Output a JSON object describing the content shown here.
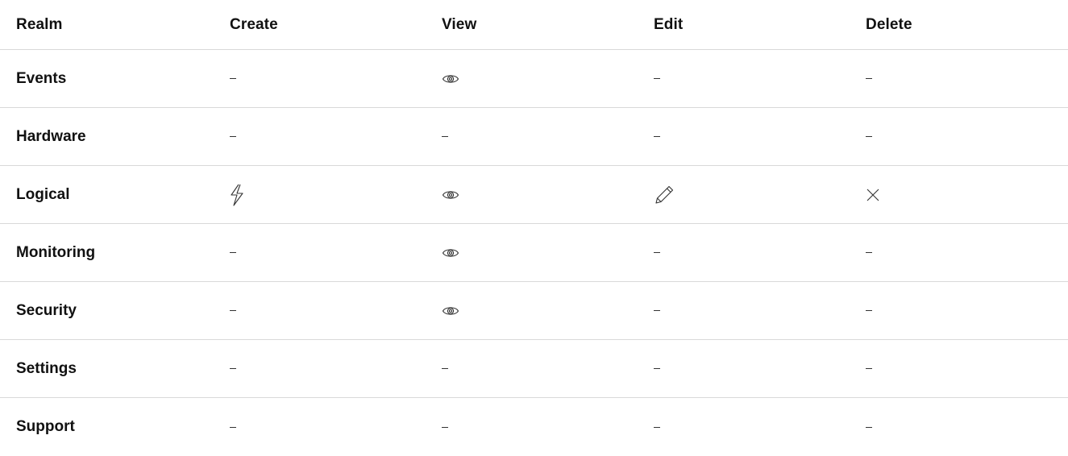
{
  "headers": {
    "realm": "Realm",
    "create": "Create",
    "view": "View",
    "edit": "Edit",
    "delete": "Delete"
  },
  "rows": [
    {
      "realm": "Events",
      "create": "none",
      "view": "eye-icon",
      "edit": "none",
      "delete": "none"
    },
    {
      "realm": "Hardware",
      "create": "none",
      "view": "none",
      "edit": "none",
      "delete": "none"
    },
    {
      "realm": "Logical",
      "create": "lightning-icon",
      "view": "eye-icon",
      "edit": "pencil-icon",
      "delete": "x-icon"
    },
    {
      "realm": "Monitoring",
      "create": "none",
      "view": "eye-icon",
      "edit": "none",
      "delete": "none"
    },
    {
      "realm": "Security",
      "create": "none",
      "view": "eye-icon",
      "edit": "none",
      "delete": "none"
    },
    {
      "realm": "Settings",
      "create": "none",
      "view": "none",
      "edit": "none",
      "delete": "none"
    },
    {
      "realm": "Support",
      "create": "none",
      "view": "none",
      "edit": "none",
      "delete": "none"
    }
  ],
  "colors": {
    "text": "#111111",
    "divider": "#d9d9d9",
    "icon": "#333333"
  }
}
